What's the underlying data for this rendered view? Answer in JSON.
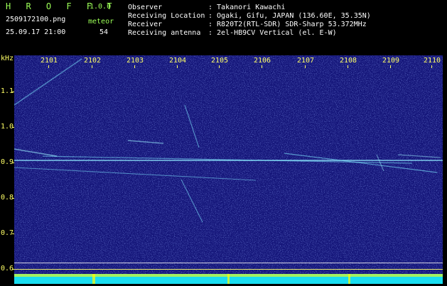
{
  "app": {
    "name_letters": "H R O F F T",
    "version": "1.0.0",
    "filename": "2509172100.png",
    "timestamp": "25.09.17 21:00",
    "meteor_label": "meteor",
    "meteor_count": "54"
  },
  "info": {
    "observer_label": "Observer",
    "observer_value": ": Takanori Kawachi",
    "location_label": "Receiving Location",
    "location_value": ": Ogaki, Gifu, JAPAN (136.60E, 35.35N)",
    "receiver_label": "Receiver",
    "receiver_value": ": R820T2(RTL-SDR) SDR-Sharp 53.372MHz",
    "antenna_label": "Receiving antenna",
    "antenna_value": ": 2el-HB9CV Vertical (el. E-W)"
  },
  "axes": {
    "y_unit": "kHz",
    "y_ticks": [
      "1.1",
      "1.0",
      "0.9",
      "0.8",
      "0.7",
      "0.6"
    ],
    "x_ticks": [
      "2101",
      "2102",
      "2103",
      "2104",
      "2105",
      "2106",
      "2107",
      "2108",
      "2109",
      "2110"
    ]
  },
  "colors": {
    "background": "#000000",
    "plot_background": "#15167a",
    "label_green": "#9cff57",
    "tick_yellow": "#ffff66",
    "signal_cyan": "#7fe8ff",
    "band_cyan": "#19ddf0"
  }
}
